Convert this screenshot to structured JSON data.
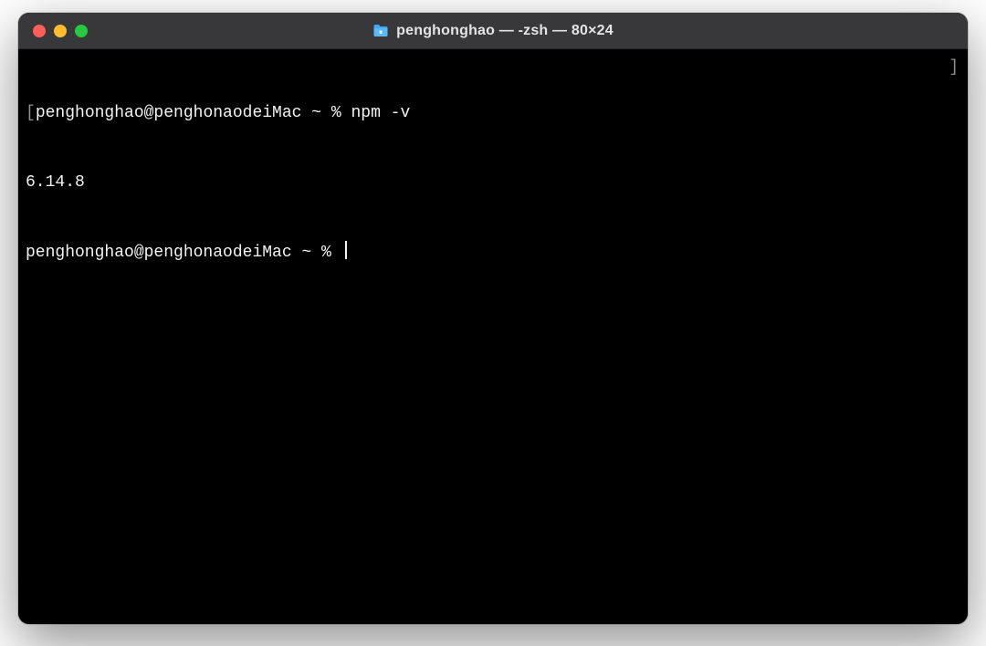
{
  "window": {
    "title": "penghonghao — -zsh — 80×24"
  },
  "terminal": {
    "lines": [
      {
        "prompt_open": "[",
        "prompt": "penghonghao@penghonaodeiMac ~ % ",
        "command": "npm -v",
        "prompt_close": "]"
      },
      {
        "output": "6.14.8"
      },
      {
        "prompt": "penghonghao@penghonaodeiMac ~ % ",
        "cursor": true
      }
    ]
  }
}
